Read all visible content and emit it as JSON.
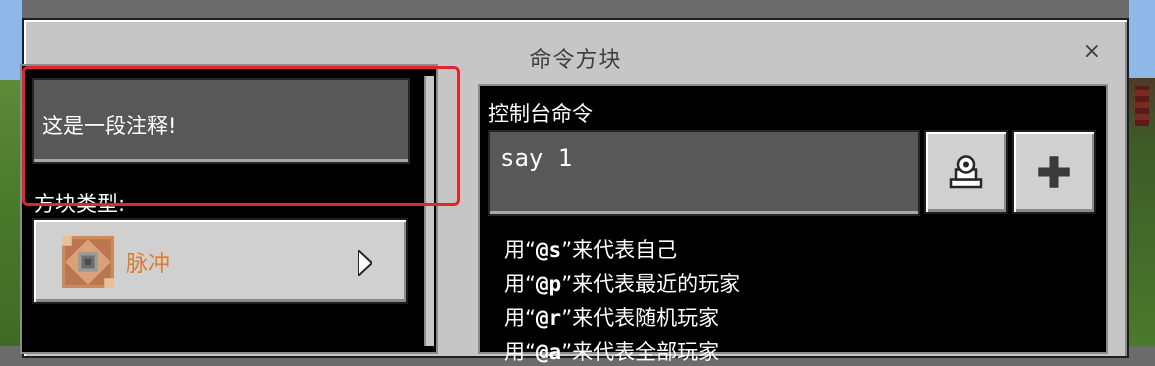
{
  "dialog": {
    "title": "命令方块",
    "close_label": "×"
  },
  "left": {
    "comment_value": "这是一段注释!",
    "block_type_label": "方块类型:",
    "block_type_value": "脉冲",
    "block_type_icon": "impulse-command-block-icon"
  },
  "right": {
    "console_label": "控制台命令",
    "command_value": "say 1",
    "history_button_icon": "output-history-icon",
    "add_button_icon": "plus-icon",
    "hints": [
      {
        "prefix": "用“",
        "selector": "@s",
        "suffix": "”来代表自己"
      },
      {
        "prefix": "用“",
        "selector": "@p",
        "suffix": "”来代表最近的玩家"
      },
      {
        "prefix": "用“",
        "selector": "@r",
        "suffix": "”来代表随机玩家"
      },
      {
        "prefix": "用“",
        "selector": "@a",
        "suffix": "”来代表全部玩家"
      }
    ]
  },
  "colors": {
    "highlight": "#e0262e",
    "block_type_value": "#e07a2e"
  }
}
